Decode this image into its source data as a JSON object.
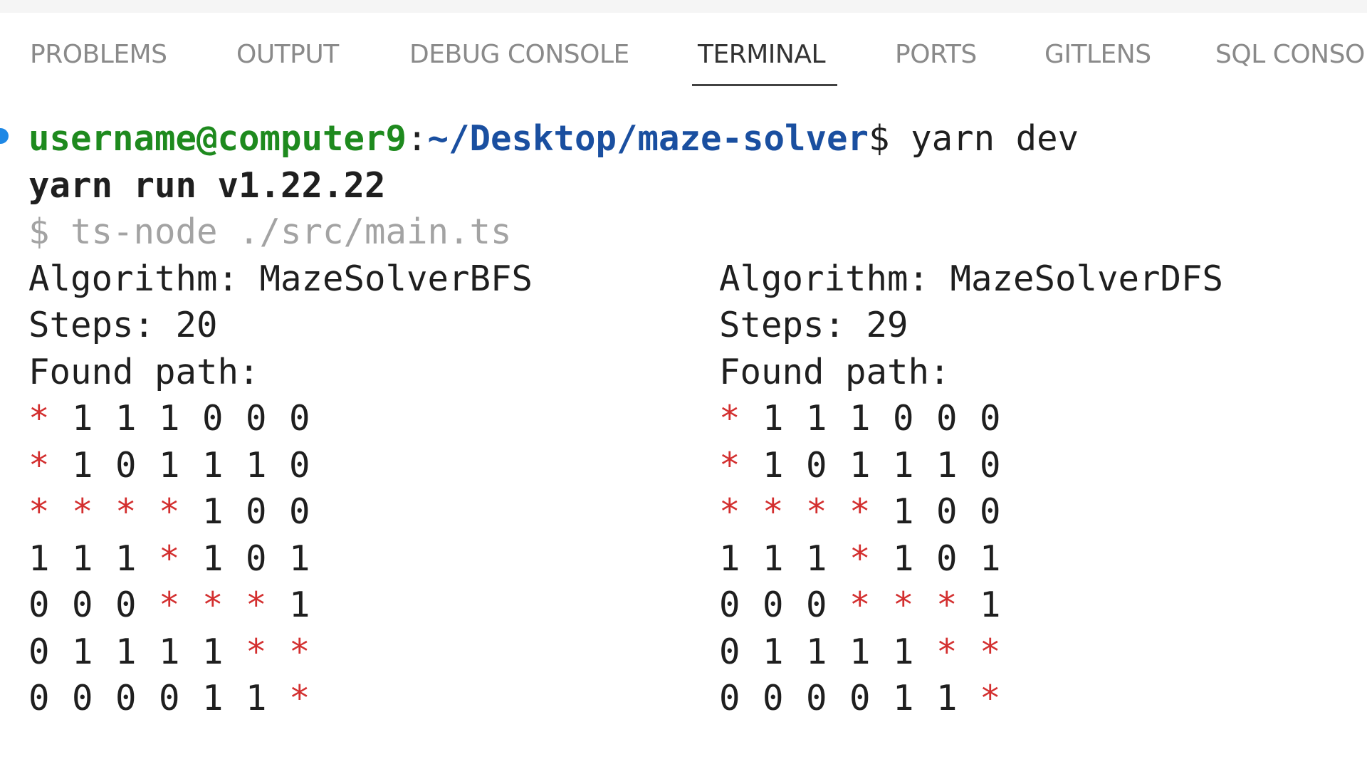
{
  "panel": {
    "tabs": [
      {
        "label": "PROBLEMS"
      },
      {
        "label": "OUTPUT"
      },
      {
        "label": "DEBUG CONSOLE"
      },
      {
        "label": "TERMINAL"
      },
      {
        "label": "PORTS"
      },
      {
        "label": "GITLENS"
      },
      {
        "label": "SQL CONSO"
      }
    ],
    "active_tab": "TERMINAL"
  },
  "terminal": {
    "prompt_user": "username@computer9",
    "prompt_sep": ":",
    "prompt_path": "~/Desktop/maze-solver",
    "prompt_symbol": "$ ",
    "command": "yarn dev",
    "yarn_line": "yarn run v1.22.22",
    "script_line": "$ ts-node ./src/main.ts",
    "left": {
      "algorithm": "Algorithm: MazeSolverBFS",
      "steps": "Steps: 20",
      "found": "Found path:",
      "grid": [
        [
          "*",
          "1",
          "1",
          "1",
          "0",
          "0",
          "0"
        ],
        [
          "*",
          "1",
          "0",
          "1",
          "1",
          "1",
          "0"
        ],
        [
          "*",
          "*",
          "*",
          "*",
          "1",
          "0",
          "0"
        ],
        [
          "1",
          "1",
          "1",
          "*",
          "1",
          "0",
          "1"
        ],
        [
          "0",
          "0",
          "0",
          "*",
          "*",
          "*",
          "1"
        ],
        [
          "0",
          "1",
          "1",
          "1",
          "1",
          "*",
          "*"
        ],
        [
          "0",
          "0",
          "0",
          "0",
          "1",
          "1",
          "*"
        ]
      ]
    },
    "right": {
      "algorithm": "Algorithm: MazeSolverDFS",
      "steps": "Steps: 29",
      "found": "Found path:",
      "grid": [
        [
          "*",
          "1",
          "1",
          "1",
          "0",
          "0",
          "0"
        ],
        [
          "*",
          "1",
          "0",
          "1",
          "1",
          "1",
          "0"
        ],
        [
          "*",
          "*",
          "*",
          "*",
          "1",
          "0",
          "0"
        ],
        [
          "1",
          "1",
          "1",
          "*",
          "1",
          "0",
          "1"
        ],
        [
          "0",
          "0",
          "0",
          "*",
          "*",
          "*",
          "1"
        ],
        [
          "0",
          "1",
          "1",
          "1",
          "1",
          "*",
          "*"
        ],
        [
          "0",
          "0",
          "0",
          "0",
          "1",
          "1",
          "*"
        ]
      ]
    },
    "colors": {
      "user": "#1e8a1e",
      "path": "#1a4fa0",
      "star": "#d32f2f",
      "dim": "#a3a3a3",
      "status_dot": "#1e88e5"
    }
  }
}
